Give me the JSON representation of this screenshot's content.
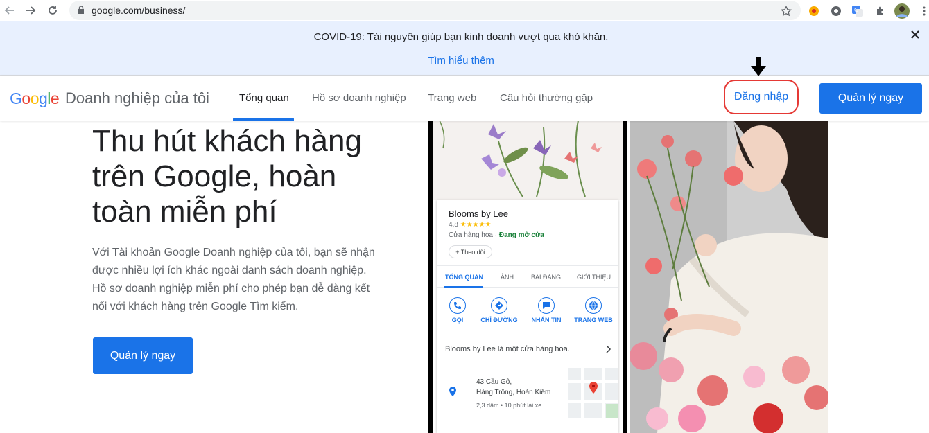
{
  "browser": {
    "url": "google.com/business/"
  },
  "banner": {
    "text": "COVID-19: Tài nguyên giúp bạn kinh doanh vượt qua khó khăn.",
    "link": "Tìm hiểu thêm"
  },
  "header": {
    "logo_letters": [
      "G",
      "o",
      "o",
      "g",
      "l",
      "e"
    ],
    "logo_colors": [
      "#4285f4",
      "#ea4335",
      "#fbbc05",
      "#4285f4",
      "#34a853",
      "#ea4335"
    ],
    "product": "Doanh nghiệp của tôi",
    "tabs": [
      "Tổng quan",
      "Hồ sơ doanh nghiệp",
      "Trang web",
      "Câu hỏi thường gặp"
    ],
    "signin": "Đăng nhập",
    "manage": "Quản lý ngay"
  },
  "hero": {
    "title": "Thu hút khách hàng trên Google, hoàn toàn miễn phí",
    "description": "Với Tài khoản Google Doanh nghiệp của tôi, bạn sẽ nhận được nhiều lợi ích khác ngoài danh sách doanh nghiệp. Hồ sơ doanh nghiệp miễn phí cho phép bạn dễ dàng kết nối với khách hàng trên Google Tìm kiếm.",
    "button": "Quản lý ngay"
  },
  "listing": {
    "name": "Blooms by Lee",
    "rating": "4,8",
    "stars": "★★★★★",
    "category": "Cửa hàng hoa · ",
    "status": "Đang mở cửa",
    "follow": "+ Theo dõi",
    "tabs": [
      "TỔNG QUAN",
      "ẢNH",
      "BÀI ĐĂNG",
      "GIỚI THIỆU"
    ],
    "actions": [
      "GỌI",
      "CHỈ ĐƯỜNG",
      "NHẮN TIN",
      "TRANG WEB"
    ],
    "about": "Blooms by Lee là một cửa hàng hoa.",
    "address_line1": "43 Cầu Gỗ,",
    "address_line2": "Hàng Trống, Hoàn Kiếm",
    "distance": "2,3 dặm • 10 phút lái xe"
  }
}
